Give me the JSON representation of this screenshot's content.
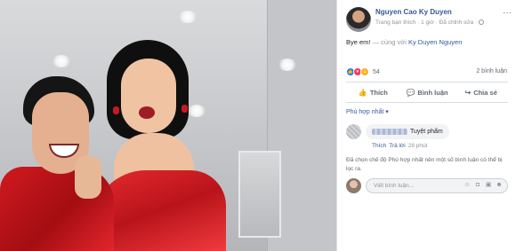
{
  "post": {
    "author_name": "Nguyen Cao Ky Duyen",
    "meta_text": "Trang bạn thích · 1 giờ · Đã chỉnh sửa ·",
    "more_icon": "…",
    "text": "Bye em!",
    "with_prefix": " — cùng với ",
    "tagged": "Ky Duyen Nguyen",
    "reaction_icons": [
      "like-icon",
      "love-icon",
      "haha-icon"
    ],
    "reaction_count": "54",
    "comment_count": "2 bình luận"
  },
  "actions": {
    "like_label": "Thích",
    "comment_label": "Bình luận",
    "share_label": "Chia sẻ"
  },
  "sort": {
    "label": "Phù hợp nhất ▾"
  },
  "comment": {
    "text": "Tuyệt phẩm",
    "like_label": "Thích",
    "reply_label": "Trả lời",
    "time": "28 phút"
  },
  "notice": {
    "text": "Đã chọn chế độ Phù hợp nhất nên một số bình luận có thể bị lọc ra."
  },
  "composer": {
    "placeholder": "Viết bình luận...",
    "icons": [
      "emoji-icon",
      "camera-icon",
      "gif-icon",
      "sticker-icon"
    ]
  },
  "colors": {
    "link": "#385898",
    "muted": "#90949c",
    "text": "#1d2129",
    "like_blue": "#2078f4",
    "dress_red": "#d01a1f"
  }
}
